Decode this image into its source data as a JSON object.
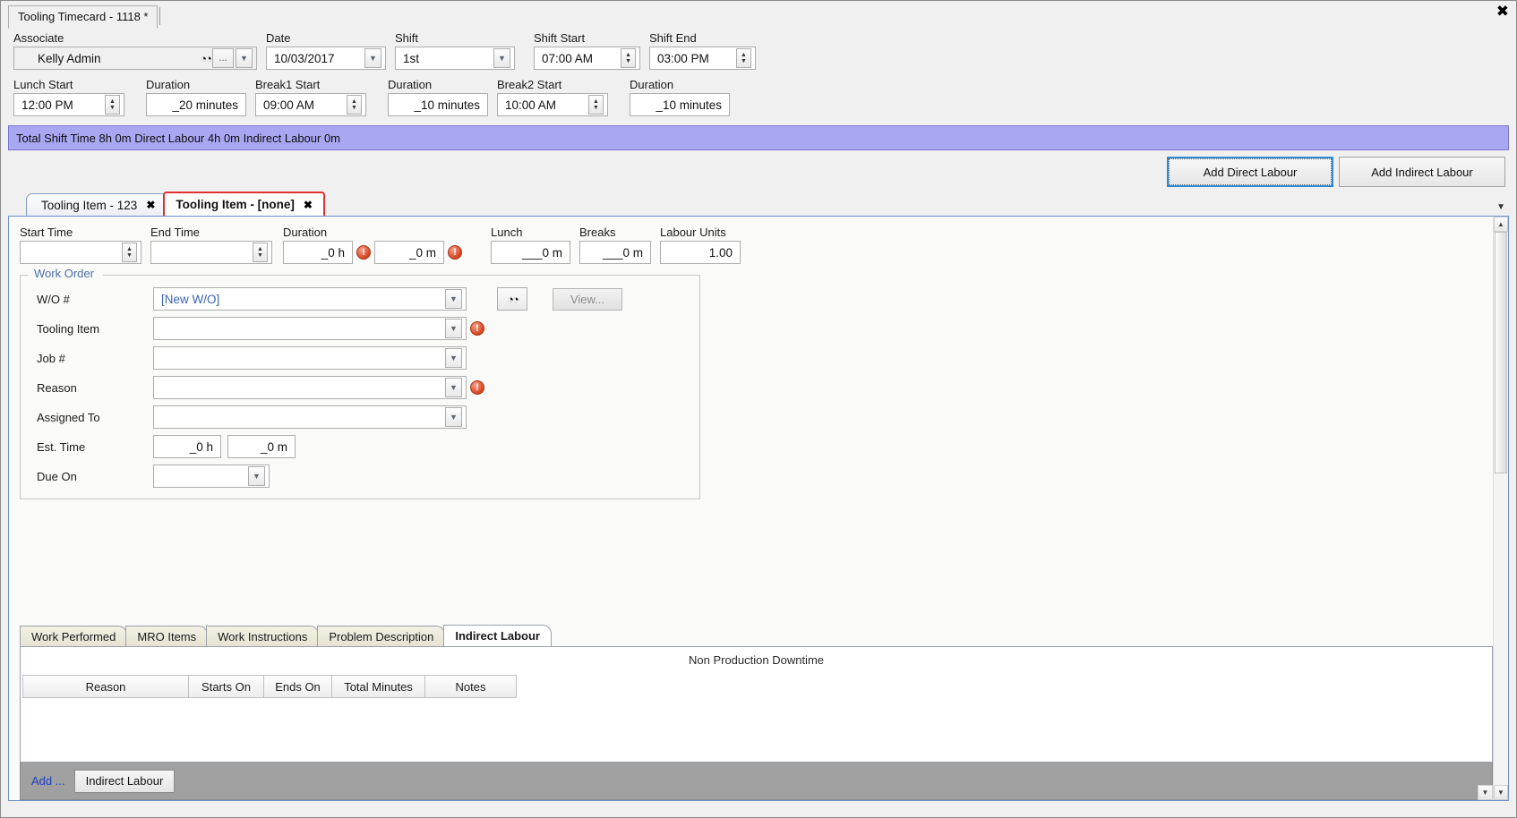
{
  "window": {
    "doc_tab_title": "Tooling Timecard - 1118 *",
    "close_icon": "close-icon",
    "close_glyph": "✖"
  },
  "header": {
    "associate": {
      "label": "Associate",
      "value": "Kelly Admin",
      "search_icon": "binoculars-icon",
      "ellipsis_label": "...",
      "dropdown_icon": "chevron-down-icon"
    },
    "date": {
      "label": "Date",
      "value": "10/03/2017"
    },
    "shift": {
      "label": "Shift",
      "value": "1st"
    },
    "shift_start": {
      "label": "Shift Start",
      "value": "07:00 AM"
    },
    "shift_end": {
      "label": "Shift End",
      "value": "03:00 PM"
    },
    "lunch_start": {
      "label": "Lunch Start",
      "value": "12:00 PM"
    },
    "lunch_duration": {
      "label": "Duration",
      "value": "_20 minutes"
    },
    "break1_start": {
      "label": "Break1 Start",
      "value": "09:00 AM"
    },
    "break1_duration": {
      "label": "Duration",
      "value": "_10 minutes"
    },
    "break2_start": {
      "label": "Break2 Start",
      "value": "10:00 AM"
    },
    "break2_duration": {
      "label": "Duration",
      "value": "_10 minutes"
    }
  },
  "status": {
    "text": "Total Shift Time 8h 0m  Direct Labour 4h 0m  Indirect Labour 0m",
    "background_color": "#a9a6f2"
  },
  "actions": {
    "add_direct_labour": "Add Direct Labour",
    "add_indirect_labour": "Add Indirect Labour",
    "focus_color": "#2e8bd4"
  },
  "tooling_tabs": {
    "items": [
      {
        "label": "Tooling Item - 123",
        "close_glyph": "✖",
        "active": false
      },
      {
        "label": "Tooling Item - [none]",
        "close_glyph": "✖",
        "active": true
      }
    ],
    "overflow_caret": "▼",
    "active_border_color": "#e03131"
  },
  "detail": {
    "start_time": {
      "label": "Start Time",
      "value": ""
    },
    "end_time": {
      "label": "End Time",
      "value": ""
    },
    "duration": {
      "label": "Duration",
      "hours": "_0 h",
      "minutes": "_0 m"
    },
    "lunch": {
      "label": "Lunch",
      "value": "___0 m"
    },
    "breaks": {
      "label": "Breaks",
      "value": "___0 m"
    },
    "labour_units": {
      "label": "Labour Units",
      "value": "1.00"
    },
    "error_glyph": "!"
  },
  "work_order": {
    "group_title": "Work Order",
    "wo_number": {
      "label": "W/O #",
      "value": "[New W/O]"
    },
    "tooling_item": {
      "label": "Tooling Item",
      "value": ""
    },
    "job_number": {
      "label": "Job #",
      "value": ""
    },
    "reason": {
      "label": "Reason",
      "value": ""
    },
    "assigned_to": {
      "label": "Assigned To",
      "value": ""
    },
    "est_time": {
      "label": "Est. Time",
      "hours": "_0 h",
      "minutes": "_0 m"
    },
    "due_on": {
      "label": "Due On",
      "value": ""
    },
    "search_button_icon": "binoculars-icon",
    "view_button": "View..."
  },
  "bottom_tabs": {
    "items": [
      {
        "label": "Work Performed",
        "active": false
      },
      {
        "label": "MRO Items",
        "active": false
      },
      {
        "label": "Work Instructions",
        "active": false
      },
      {
        "label": "Problem Description",
        "active": false
      },
      {
        "label": "Indirect Labour",
        "active": true
      }
    ]
  },
  "grid": {
    "caption": "Non Production Downtime",
    "columns": [
      "Reason",
      "Starts On",
      "Ends On",
      "Total Minutes",
      "Notes"
    ],
    "rows": [],
    "footer": {
      "add_label": "Add ...",
      "indirect_labour_label": "Indirect Labour"
    }
  }
}
